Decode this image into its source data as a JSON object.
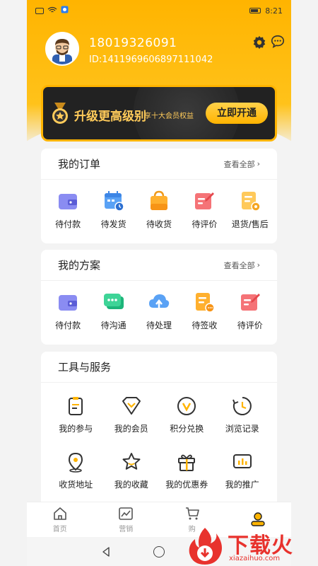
{
  "status_bar": {
    "time": "8:21"
  },
  "profile": {
    "phone": "18019326091",
    "id_line": "ID:1411969606897111042"
  },
  "vip_banner": {
    "title": "升级更高级别",
    "subtitle": "享十大会员权益",
    "button": "立即开通"
  },
  "orders": {
    "title": "我的订单",
    "view_all": "查看全部",
    "items": [
      {
        "label": "待付款",
        "icon": "wallet-icon"
      },
      {
        "label": "待发货",
        "icon": "calendar-clock-icon"
      },
      {
        "label": "待收货",
        "icon": "shopping-bag-icon"
      },
      {
        "label": "待评价",
        "icon": "edit-card-icon"
      },
      {
        "label": "退货/售后",
        "icon": "return-document-icon"
      }
    ]
  },
  "plans": {
    "title": "我的方案",
    "view_all": "查看全部",
    "items": [
      {
        "label": "待付款",
        "icon": "wallet-icon"
      },
      {
        "label": "待沟通",
        "icon": "chat-bubble-icon"
      },
      {
        "label": "待处理",
        "icon": "cloud-upload-icon"
      },
      {
        "label": "待签收",
        "icon": "document-icon"
      },
      {
        "label": "待评价",
        "icon": "edit-card-icon"
      }
    ]
  },
  "tools": {
    "title": "工具与服务",
    "items": [
      {
        "label": "我的参与",
        "icon": "clipboard-icon"
      },
      {
        "label": "我的会员",
        "icon": "diamond-icon"
      },
      {
        "label": "积分兑换",
        "icon": "points-icon"
      },
      {
        "label": "浏览记录",
        "icon": "history-icon"
      },
      {
        "label": "收货地址",
        "icon": "location-pin-icon"
      },
      {
        "label": "我的收藏",
        "icon": "star-icon"
      },
      {
        "label": "我的优惠券",
        "icon": "gift-icon"
      },
      {
        "label": "我的推广",
        "icon": "chart-icon"
      }
    ]
  },
  "tabbar": {
    "tabs": [
      {
        "label": "首页",
        "icon": "home-icon"
      },
      {
        "label": "营销",
        "icon": "trend-icon"
      },
      {
        "label": "购",
        "icon": "cart-icon"
      },
      {
        "label": "",
        "icon": "user-icon",
        "active": true
      }
    ]
  },
  "watermark": {
    "brand": "下载火",
    "url": "xiazaihuo.com"
  },
  "colors": {
    "accent": "#ffb400",
    "vip_gold": "#ffcb5a",
    "watermark_red": "#e8322d"
  }
}
